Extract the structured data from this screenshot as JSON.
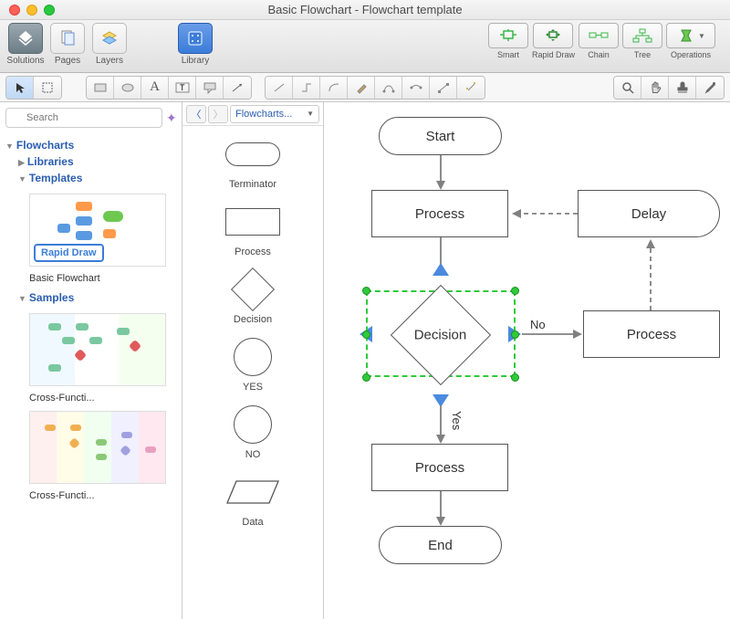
{
  "window": {
    "title": "Basic Flowchart - Flowchart template"
  },
  "toolbar": {
    "tabs": [
      "Solutions",
      "Pages",
      "Layers"
    ],
    "library_label": "Library",
    "modes": [
      "Smart",
      "Rapid Draw",
      "Chain",
      "Tree",
      "Operations"
    ]
  },
  "sidebar": {
    "search_placeholder": "Search",
    "root": "Flowcharts",
    "libraries": "Libraries",
    "templates": "Templates",
    "samples": "Samples",
    "template_items": [
      {
        "label": "Basic Flowchart",
        "badge": "Rapid Draw"
      }
    ],
    "sample_items": [
      {
        "label": "Cross-Functi..."
      },
      {
        "label": "Cross-Functi..."
      }
    ]
  },
  "shapes_panel": {
    "library_name": "Flowcharts...",
    "shapes": [
      "Terminator",
      "Process",
      "Decision",
      "YES",
      "NO",
      "Data"
    ]
  },
  "flowchart": {
    "nodes": {
      "start": "Start",
      "p1": "Process",
      "decision": "Decision",
      "p2": "Process",
      "end": "End",
      "delay": "Delay",
      "p3": "Process"
    },
    "edges": {
      "no": "No",
      "yes": "Yes"
    }
  }
}
